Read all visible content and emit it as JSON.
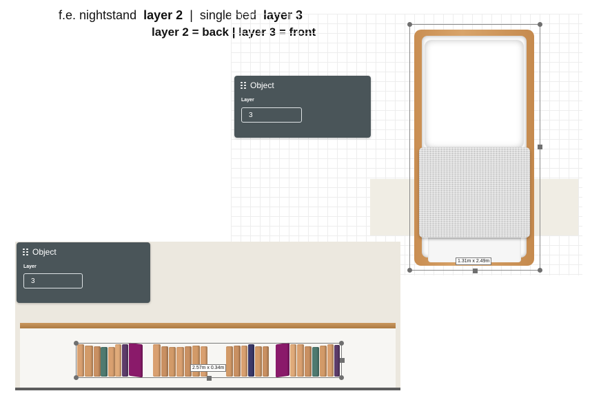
{
  "captions": {
    "line1_a": "f.e. nightstand",
    "line1_b": "layer 2",
    "line1_sep": "|",
    "line1_c": "single bed",
    "line1_d": "layer 3",
    "line2": "layer 2 = back  |  layer 3 = front"
  },
  "panel_top": {
    "title": "Object",
    "layer_label": "Layer",
    "layer_value": "3"
  },
  "panel_bottom": {
    "title": "Object",
    "layer_label": "Layer",
    "layer_value": "3"
  },
  "bed": {
    "dimensions": "1.31m x 2.49m"
  },
  "bookshelf": {
    "dimensions": "2.57m x 0.34m"
  },
  "colors": {
    "panel_bg": "#4a5559",
    "wood": "#c98e52",
    "book_tan": "#d9a070",
    "book_purple": "#8a1a6a",
    "book_teal": "#4f7a70"
  },
  "icons": {
    "panel_grip": "drag-grip-icon"
  }
}
